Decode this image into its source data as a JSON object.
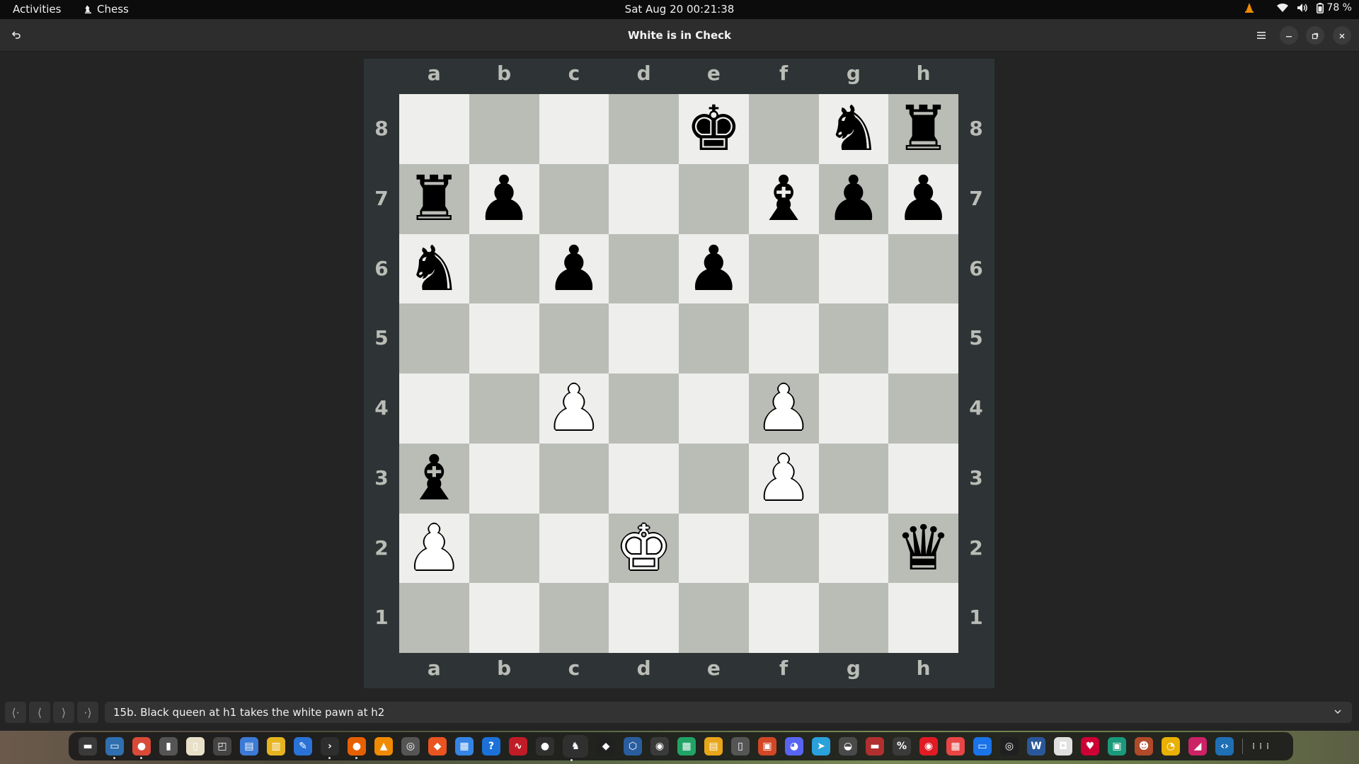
{
  "topbar": {
    "activities": "Activities",
    "app_name": "Chess",
    "clock": "Sat Aug 20  00:21:38",
    "battery": "78 %"
  },
  "window": {
    "title": "White is in Check"
  },
  "board": {
    "files": [
      "a",
      "b",
      "c",
      "d",
      "e",
      "f",
      "g",
      "h"
    ],
    "ranks": [
      "8",
      "7",
      "6",
      "5",
      "4",
      "3",
      "2",
      "1"
    ],
    "light_color": "#eeeeec",
    "dark_color": "#babdb6",
    "pieces": [
      {
        "square": "e8",
        "color": "black",
        "type": "king",
        "glyph": "♚"
      },
      {
        "square": "g8",
        "color": "black",
        "type": "knight",
        "glyph": "♞"
      },
      {
        "square": "h8",
        "color": "black",
        "type": "rook",
        "glyph": "♜"
      },
      {
        "square": "a7",
        "color": "black",
        "type": "rook",
        "glyph": "♜"
      },
      {
        "square": "b7",
        "color": "black",
        "type": "pawn",
        "glyph": "♟"
      },
      {
        "square": "f7",
        "color": "black",
        "type": "bishop",
        "glyph": "♝"
      },
      {
        "square": "g7",
        "color": "black",
        "type": "pawn",
        "glyph": "♟"
      },
      {
        "square": "h7",
        "color": "black",
        "type": "pawn",
        "glyph": "♟"
      },
      {
        "square": "a6",
        "color": "black",
        "type": "knight",
        "glyph": "♞"
      },
      {
        "square": "c6",
        "color": "black",
        "type": "pawn",
        "glyph": "♟"
      },
      {
        "square": "e6",
        "color": "black",
        "type": "pawn",
        "glyph": "♟"
      },
      {
        "square": "c4",
        "color": "white",
        "type": "pawn",
        "glyph": "♟"
      },
      {
        "square": "f4",
        "color": "white",
        "type": "pawn",
        "glyph": "♟"
      },
      {
        "square": "a3",
        "color": "black",
        "type": "bishop",
        "glyph": "♝"
      },
      {
        "square": "f3",
        "color": "white",
        "type": "pawn",
        "glyph": "♟"
      },
      {
        "square": "a2",
        "color": "white",
        "type": "pawn",
        "glyph": "♟"
      },
      {
        "square": "d2",
        "color": "white",
        "type": "king",
        "glyph": "♚"
      },
      {
        "square": "h2",
        "color": "black",
        "type": "queen",
        "glyph": "♛"
      }
    ]
  },
  "navigation": {
    "buttons": [
      {
        "name": "first-move-button",
        "glyph": "⟨·"
      },
      {
        "name": "previous-move-button",
        "glyph": "⟨"
      },
      {
        "name": "next-move-button",
        "glyph": "⟩"
      },
      {
        "name": "last-move-button",
        "glyph": "·⟩"
      }
    ],
    "current_move": "15b. Black queen at h1 takes the white pawn at h2"
  },
  "dock": {
    "apps": [
      {
        "name": "files-drawer",
        "color": "#3a3a3a",
        "glyph": "▬"
      },
      {
        "name": "files",
        "color": "#2f6fb0",
        "glyph": "▭"
      },
      {
        "name": "chrome",
        "color": "#d94a38",
        "glyph": "●"
      },
      {
        "name": "notes",
        "color": "#555555",
        "glyph": "▮"
      },
      {
        "name": "text-editor",
        "color": "#e8e0c8",
        "glyph": "▯"
      },
      {
        "name": "screenshot",
        "color": "#444444",
        "glyph": "◰"
      },
      {
        "name": "document-viewer",
        "color": "#3d7ad6",
        "glyph": "▤"
      },
      {
        "name": "archive",
        "color": "#e6b420",
        "glyph": "▥"
      },
      {
        "name": "writer",
        "color": "#2a72d5",
        "glyph": "✎"
      },
      {
        "name": "terminal",
        "color": "#2e2e2e",
        "glyph": "›"
      },
      {
        "name": "firefox",
        "color": "#e66000",
        "glyph": "●"
      },
      {
        "name": "vlc",
        "color": "#f08a00",
        "glyph": "▲"
      },
      {
        "name": "disks",
        "color": "#555555",
        "glyph": "◎"
      },
      {
        "name": "software",
        "color": "#e95420",
        "glyph": "◆"
      },
      {
        "name": "calendar",
        "color": "#3584e4",
        "glyph": "▦"
      },
      {
        "name": "help",
        "color": "#1c71d8",
        "glyph": "?"
      },
      {
        "name": "system-monitor",
        "color": "#c01c28",
        "glyph": "∿"
      },
      {
        "name": "webcam",
        "color": "#303030",
        "glyph": "●"
      },
      {
        "name": "chess",
        "color": "#303030",
        "glyph": "♞"
      },
      {
        "name": "inkscape",
        "color": "#202020",
        "glyph": "◆"
      },
      {
        "name": "virtualbox",
        "color": "#2a5d9e",
        "glyph": "⬡"
      },
      {
        "name": "obs",
        "color": "#3a3a3a",
        "glyph": "◉"
      },
      {
        "name": "calc",
        "color": "#21a366",
        "glyph": "▦"
      },
      {
        "name": "impress",
        "color": "#e8a51a",
        "glyph": "▤"
      },
      {
        "name": "document",
        "color": "#555555",
        "glyph": "▯"
      },
      {
        "name": "presentation",
        "color": "#d24726",
        "glyph": "▣"
      },
      {
        "name": "discord",
        "color": "#5865f2",
        "glyph": "◕"
      },
      {
        "name": "telegram",
        "color": "#2aa1da",
        "glyph": "➤"
      },
      {
        "name": "game",
        "color": "#4a4a4a",
        "glyph": "◒"
      },
      {
        "name": "flashcards",
        "color": "#b03030",
        "glyph": "▬"
      },
      {
        "name": "equation",
        "color": "#3a3a3a",
        "glyph": "%"
      },
      {
        "name": "recorder",
        "color": "#e01b24",
        "glyph": "◉"
      },
      {
        "name": "calendar-red",
        "color": "#e84545",
        "glyph": "▦"
      },
      {
        "name": "presenter",
        "color": "#1a73e8",
        "glyph": "▭"
      },
      {
        "name": "steam",
        "color": "#202020",
        "glyph": "◎"
      },
      {
        "name": "word-app",
        "color": "#2b579a",
        "glyph": "W"
      },
      {
        "name": "camera",
        "color": "#e0e0e0",
        "glyph": "◘"
      },
      {
        "name": "bookmark",
        "color": "#cc0033",
        "glyph": "♥"
      },
      {
        "name": "image-viewer",
        "color": "#1a9a7a",
        "glyph": "▣"
      },
      {
        "name": "game-character",
        "color": "#b04a2a",
        "glyph": "☻"
      },
      {
        "name": "pacman",
        "color": "#e8b000",
        "glyph": "◔"
      },
      {
        "name": "video-editor",
        "color": "#cc2266",
        "glyph": "◢"
      },
      {
        "name": "code",
        "color": "#1f6fb5",
        "glyph": "‹›"
      }
    ],
    "show_apps_glyph": "⋮⋮⋮"
  }
}
